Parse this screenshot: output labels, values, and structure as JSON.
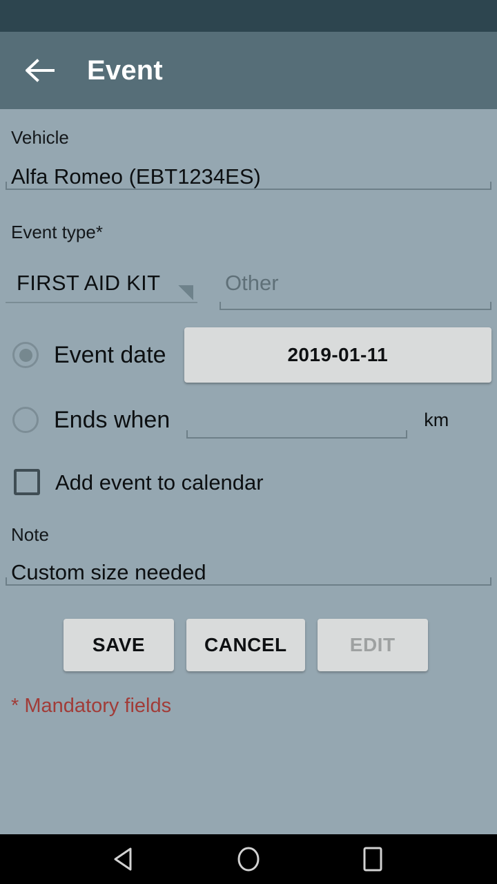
{
  "app_bar": {
    "back_icon": "back-arrow-icon",
    "title": "Event"
  },
  "form": {
    "vehicle": {
      "label": "Vehicle",
      "value": "Alfa Romeo (EBT1234ES)"
    },
    "event_type": {
      "label": "Event type*",
      "spinner_value": "FIRST AID KIT",
      "spinner_icon": "dropdown-triangle-icon",
      "other_placeholder": "Other",
      "other_value": ""
    },
    "event_date": {
      "label": "Event date",
      "selected": true,
      "date_value": "2019-01-11"
    },
    "ends_when": {
      "label": "Ends when",
      "selected": false,
      "value": "",
      "unit": "km"
    },
    "add_to_calendar": {
      "label": "Add event to calendar",
      "checked": false
    },
    "note": {
      "label": "Note",
      "value": "Custom size needed"
    }
  },
  "buttons": {
    "save": "SAVE",
    "cancel": "CANCEL",
    "edit": "EDIT"
  },
  "footer": {
    "mandatory_note": "* Mandatory fields"
  },
  "nav_bar": {
    "back": "nav-back-icon",
    "home": "nav-home-icon",
    "recents": "nav-recents-icon"
  },
  "colors": {
    "status_bar": "#2d454f",
    "app_bar": "#566e78",
    "background": "#95a7b1",
    "button_face": "#d9dbdb",
    "mandatory_text": "#a13c38",
    "nav_bar": "#000000"
  }
}
